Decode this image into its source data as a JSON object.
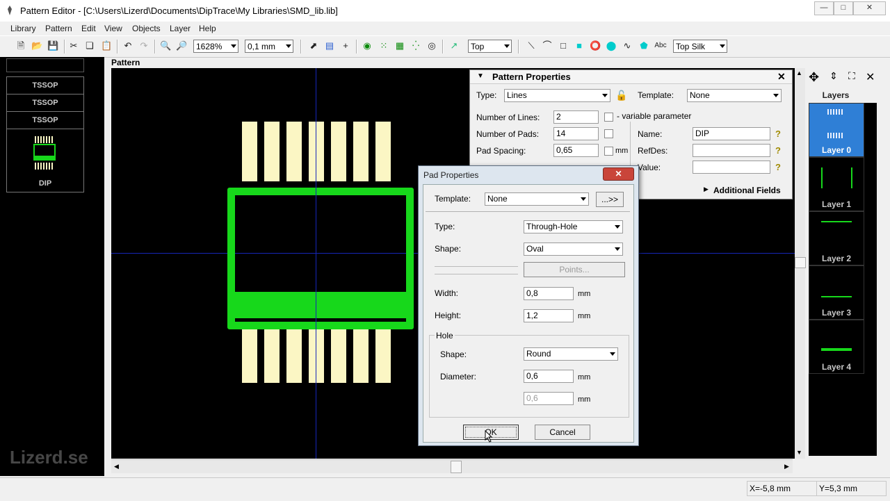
{
  "window": {
    "title": "Pattern Editor - [C:\\Users\\Lizerd\\Documents\\DipTrace\\My Libraries\\SMD_lib.lib]"
  },
  "menu": [
    "Library",
    "Pattern",
    "Edit",
    "View",
    "Objects",
    "Layer",
    "Help"
  ],
  "toolbar": {
    "zoom": "1628%",
    "grid": "0,1 mm",
    "side": "Top",
    "silk_layer": "Top Silk",
    "text_tool": "Abc"
  },
  "library": {
    "items": [
      "TSSOP",
      "TSSOP",
      "TSSOP",
      "DIP"
    ]
  },
  "canvas": {
    "label": "Pattern"
  },
  "pattern_props": {
    "title": "Pattern Properties",
    "type_label": "Type:",
    "type_value": "Lines",
    "template_label": "Template:",
    "template_value": "None",
    "num_lines_label": "Number of Lines:",
    "num_lines_value": "2",
    "variable_param": "- variable parameter",
    "num_pads_label": "Number of Pads:",
    "num_pads_value": "14",
    "pad_spacing_label": "Pad Spacing:",
    "pad_spacing_value": "0,65",
    "unit": "mm",
    "name_label": "Name:",
    "name_value": "DIP",
    "refdes_label": "RefDes:",
    "value_label": "Value:",
    "additional_fields": "Additional Fields"
  },
  "pad_dialog": {
    "title": "Pad Properties",
    "template_label": "Template:",
    "template_value": "None",
    "more_button": "...>>",
    "type_label": "Type:",
    "type_value": "Through-Hole",
    "shape_label": "Shape:",
    "shape_value": "Oval",
    "points_button": "Points...",
    "width_label": "Width:",
    "width_value": "0,8",
    "height_label": "Height:",
    "height_value": "1,2",
    "unit": "mm",
    "hole_label": "Hole",
    "hole_shape_label": "Shape:",
    "hole_shape_value": "Round",
    "diameter_label": "Diameter:",
    "diameter_value": "0,6",
    "diameter2_value": "0,6",
    "ok_button": "OK",
    "cancel_button": "Cancel"
  },
  "layers": {
    "header": "Layers",
    "items": [
      "Layer 0",
      "Layer 1",
      "Layer 2",
      "Layer 3",
      "Layer 4"
    ]
  },
  "status": {
    "x": "X=-5,8 mm",
    "y": "Y=5,3 mm"
  },
  "watermark": "Lizerd.se",
  "colors": {
    "pad": "#fbf6c4",
    "silk": "#17d81b",
    "crosshair": "#1626b8",
    "layer_selected": "#2f7fd6"
  }
}
